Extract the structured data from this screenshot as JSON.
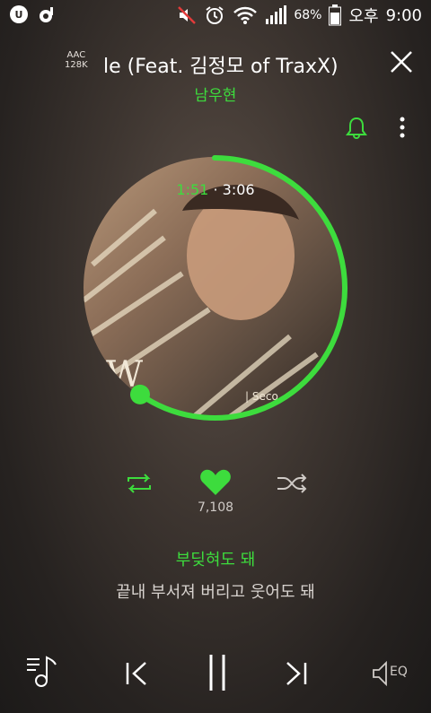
{
  "status_bar": {
    "battery_percent": "68%",
    "ampm": "오후",
    "time": "9:00",
    "icons": [
      "u-plus-icon",
      "music-note-icon",
      "mute-icon",
      "alarm-icon",
      "wifi-icon",
      "signal-icon",
      "battery-icon"
    ]
  },
  "player": {
    "codec": "AAC",
    "bitrate": "128K",
    "song_title": "le (Feat. 김정모 of TraxX)",
    "artist": "남우현",
    "elapsed": "1:51",
    "separator": "·",
    "total": "3:06",
    "progress_fraction": 0.597,
    "cover_mark": "W",
    "cover_small_text": "| Seco",
    "like_count": "7,108",
    "lyrics": {
      "current": "부딪혀도 돼",
      "next": "끝내 부서져 버리고 웃어도 돼"
    },
    "eq_label": "EQ"
  },
  "colors": {
    "accent": "#3ddc3d",
    "text": "#ffffff",
    "muted": "#cfcac6"
  }
}
